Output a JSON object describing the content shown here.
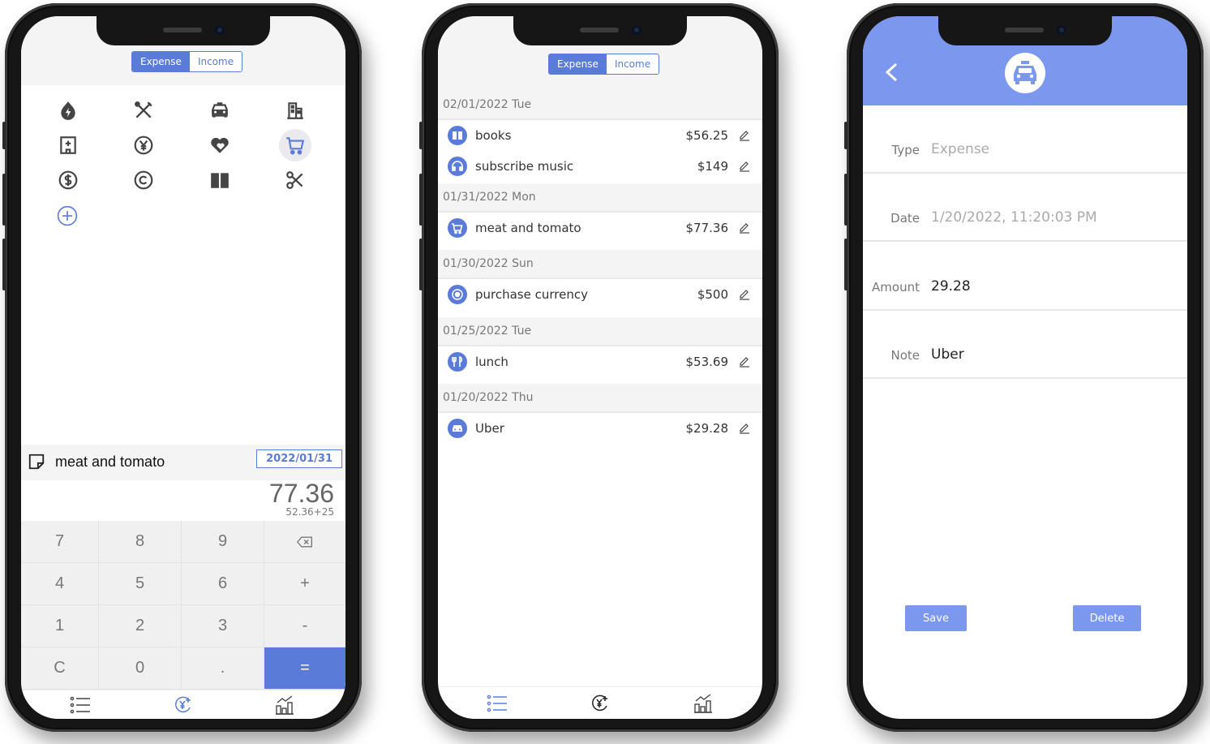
{
  "segment": {
    "expense": "Expense",
    "income": "Income"
  },
  "entry": {
    "note": "meat and tomato",
    "date": "2022/01/31",
    "amount": "77.36",
    "expression": "52.36+25",
    "keys": [
      "7",
      "8",
      "9",
      "backspace",
      "4",
      "5",
      "6",
      "+",
      "1",
      "2",
      "3",
      "-",
      "C",
      "0",
      ".",
      "="
    ]
  },
  "icons": [
    "fire-icon",
    "tools-icon",
    "car-icon",
    "building-icon",
    "hospital-icon",
    "yen-icon",
    "hearts-icon",
    "cart-icon",
    "dollar-icon",
    "circle-icon",
    "book-icon",
    "scissors-icon",
    "plus-icon"
  ],
  "ledger": {
    "days": [
      {
        "date": "02/01/2022 Tue",
        "items": [
          {
            "name": "books",
            "amount": "$56.25",
            "icon": "book-icon"
          },
          {
            "name": "subscribe music",
            "amount": "$149",
            "icon": "headphones-icon"
          }
        ]
      },
      {
        "date": "01/31/2022 Mon",
        "items": [
          {
            "name": "meat and tomato",
            "amount": "$77.36",
            "icon": "cart-icon"
          }
        ]
      },
      {
        "date": "01/30/2022 Sun",
        "items": [
          {
            "name": "purchase currency",
            "amount": "$500",
            "icon": "currency-icon"
          }
        ]
      },
      {
        "date": "01/25/2022 Tue",
        "items": [
          {
            "name": "lunch",
            "amount": "$53.69",
            "icon": "fork-knife-icon"
          }
        ]
      },
      {
        "date": "01/20/2022 Thu",
        "items": [
          {
            "name": "Uber",
            "amount": "$29.28",
            "icon": "car-icon"
          }
        ]
      }
    ]
  },
  "detail": {
    "type_label": "Type",
    "type_value": "Expense",
    "date_label": "Date",
    "date_value": "1/20/2022, 11:20:03 PM",
    "amount_label": "Amount",
    "amount_value": "29.28",
    "note_label": "Note",
    "note_value": "Uber",
    "save": "Save",
    "delete": "Delete"
  },
  "colors": {
    "accent": "#5b7bd8",
    "header": "#7b97ee",
    "background": "#f4f4f4"
  }
}
